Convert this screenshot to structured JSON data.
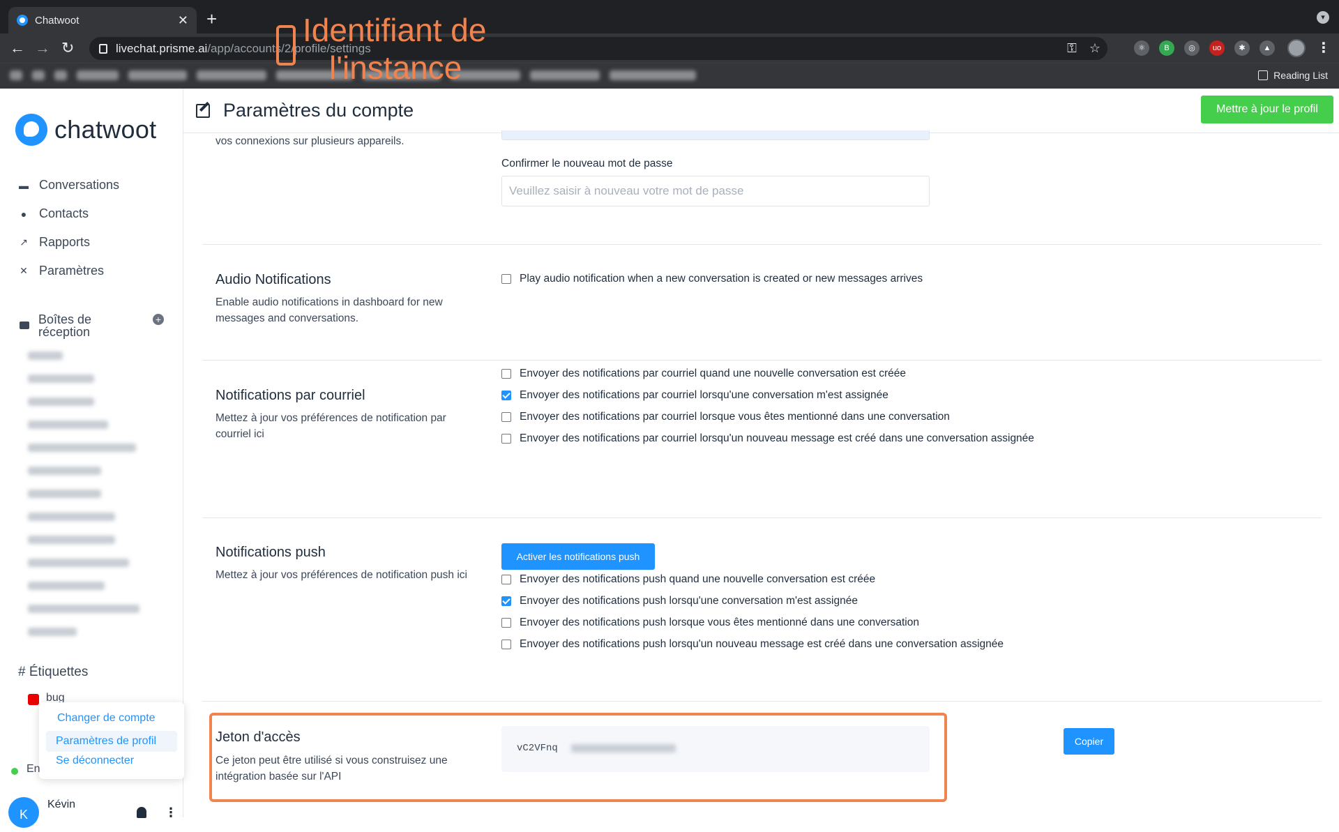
{
  "browser": {
    "tab_title": "Chatwoot",
    "url_host": "livechat.prisme.ai",
    "url_path": "/app/accounts/2/profile/settings",
    "reading_list": "Reading List",
    "extensions": [
      {
        "name": "react-icon",
        "color": "#5f6368",
        "label": "⚛"
      },
      {
        "name": "extension-b-icon",
        "color": "#34a853",
        "label": "B"
      },
      {
        "name": "target-icon",
        "color": "#5f6368",
        "label": "◎"
      },
      {
        "name": "ublock-icon",
        "color": "#c5221f",
        "label": "uo"
      },
      {
        "name": "puzzle-icon",
        "color": "#5f6368",
        "label": "✱"
      },
      {
        "name": "flask-icon",
        "color": "#5f6368",
        "label": "▲"
      }
    ]
  },
  "annotation": {
    "line1": "Identifiant de",
    "line2": "l'instance",
    "color": "#f0834e"
  },
  "sidebar": {
    "logo": "chatwoot",
    "nav": [
      {
        "label": "Conversations",
        "icon": "chat-icon"
      },
      {
        "label": "Contacts",
        "icon": "user-icon"
      },
      {
        "label": "Rapports",
        "icon": "chart-icon"
      },
      {
        "label": "Paramètres",
        "icon": "tools-icon"
      }
    ],
    "inbox_title": "Boîtes de réception",
    "labels_title": "Étiquettes",
    "label_bug": "bug",
    "menu": {
      "switch_account": "Changer de compte",
      "profile_settings": "Paramètres de profil",
      "logout": "Se déconnecter"
    },
    "status": "En",
    "user_initial": "K",
    "user_name": "Kévin"
  },
  "header": {
    "title": "Paramètres du compte",
    "update_button": "Mettre à jour le profil"
  },
  "password": {
    "desc_tail": "vos connexions sur plusieurs appareils.",
    "confirm_label": "Confirmer le nouveau mot de passe",
    "confirm_placeholder": "Veuillez saisir à nouveau votre mot de passe"
  },
  "audio": {
    "title": "Audio Notifications",
    "desc": "Enable audio notifications in dashboard for new messages and conversations.",
    "option": "Play audio notification when a new conversation is created or new messages arrives"
  },
  "email_notifications": {
    "title": "Notifications par courriel",
    "desc": "Mettez à jour vos préférences de notification par courriel ici",
    "options": [
      {
        "label": "Envoyer des notifications par courriel quand une nouvelle conversation est créée",
        "checked": false
      },
      {
        "label": "Envoyer des notifications par courriel lorsqu'une conversation m'est assignée",
        "checked": true
      },
      {
        "label": "Envoyer des notifications par courriel lorsque vous êtes mentionné dans une conversation",
        "checked": false
      },
      {
        "label": "Envoyer des notifications par courriel lorsqu'un nouveau message est créé dans une conversation assignée",
        "checked": false
      }
    ]
  },
  "push_notifications": {
    "title": "Notifications push",
    "desc": "Mettez à jour vos préférences de notification push ici",
    "enable_button": "Activer les notifications push",
    "options": [
      {
        "label": "Envoyer des notifications push quand une nouvelle conversation est créée",
        "checked": false
      },
      {
        "label": "Envoyer des notifications push lorsqu'une conversation m'est assignée",
        "checked": true
      },
      {
        "label": "Envoyer des notifications push lorsque vous êtes mentionné dans une conversation",
        "checked": false
      },
      {
        "label": "Envoyer des notifications push lorsqu'un nouveau message est créé dans une conversation assignée",
        "checked": false
      }
    ]
  },
  "access_token": {
    "title": "Jeton d'accès",
    "desc": "Ce jeton peut être utilisé si vous construisez une intégration basée sur l'API",
    "token_visible": "vC2VFnq",
    "copy_button": "Copier"
  }
}
